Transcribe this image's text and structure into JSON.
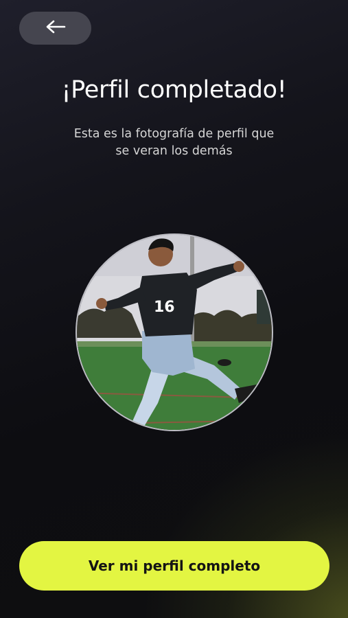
{
  "header": {
    "back_icon": "arrow-left-icon"
  },
  "main": {
    "title": "¡Perfil completado!",
    "subtitle_line1": "Esta es la fotografía de perfil que",
    "subtitle_line2": "se veran los demás",
    "photo_jersey_number": "16"
  },
  "footer": {
    "cta_label": "Ver mi perfil completo"
  },
  "colors": {
    "accent": "#e3f542",
    "back_button_bg": "#45454f",
    "background": "#0e0e10"
  }
}
